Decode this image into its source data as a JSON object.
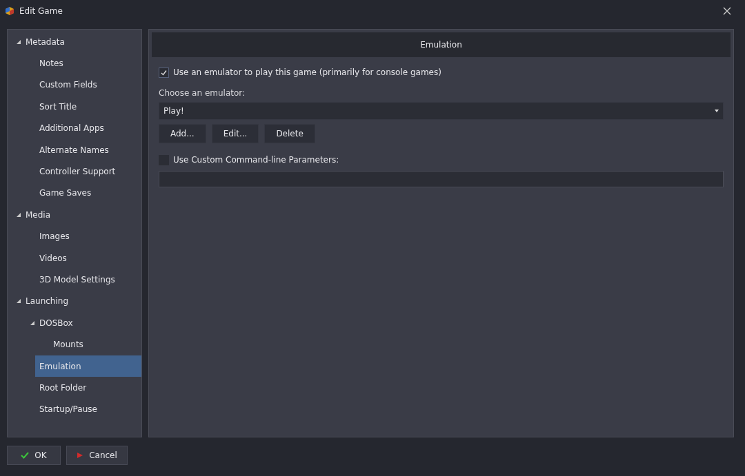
{
  "window": {
    "title": "Edit Game"
  },
  "sidebar": {
    "items": [
      {
        "label": "Metadata",
        "expanded": true,
        "selected": false,
        "children": [
          {
            "label": "Notes",
            "selected": false
          },
          {
            "label": "Custom Fields",
            "selected": false
          },
          {
            "label": "Sort Title",
            "selected": false
          },
          {
            "label": "Additional Apps",
            "selected": false
          },
          {
            "label": "Alternate Names",
            "selected": false
          },
          {
            "label": "Controller Support",
            "selected": false
          },
          {
            "label": "Game Saves",
            "selected": false
          }
        ]
      },
      {
        "label": "Media",
        "expanded": true,
        "selected": false,
        "children": [
          {
            "label": "Images",
            "selected": false
          },
          {
            "label": "Videos",
            "selected": false
          },
          {
            "label": "3D Model Settings",
            "selected": false
          }
        ]
      },
      {
        "label": "Launching",
        "expanded": true,
        "selected": false,
        "children": [
          {
            "label": "DOSBox",
            "expanded": true,
            "selected": false,
            "children": [
              {
                "label": "Mounts",
                "selected": false
              }
            ]
          },
          {
            "label": "Emulation",
            "selected": true
          },
          {
            "label": "Root Folder",
            "selected": false
          },
          {
            "label": "Startup/Pause",
            "selected": false
          }
        ]
      }
    ]
  },
  "panel": {
    "title": "Emulation",
    "use_emulator": {
      "label": "Use an emulator to play this game (primarily for console games)",
      "checked": true
    },
    "emulator_label": "Choose an emulator:",
    "emulator_select": {
      "value": "Play!"
    },
    "buttons": [
      "Add...",
      "Edit...",
      "Delete"
    ],
    "custom_params": {
      "label": "Use Custom Command-line Parameters:",
      "checked": false
    }
  },
  "footer": {
    "buttons": [
      {
        "kind": "ok",
        "label": "OK"
      },
      {
        "kind": "cancel",
        "label": "Cancel"
      }
    ]
  }
}
